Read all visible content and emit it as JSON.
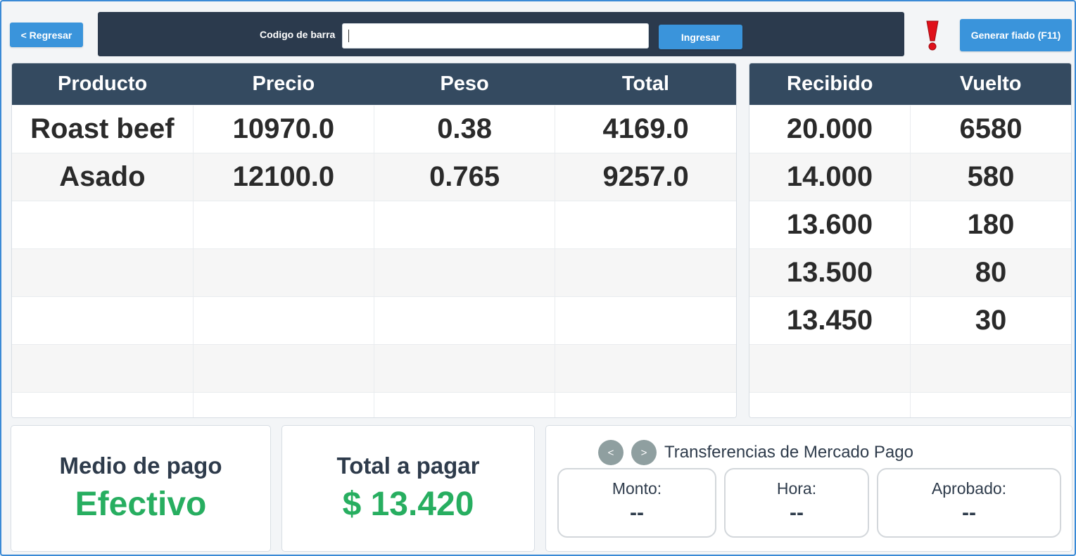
{
  "header": {
    "back_label": "< Regresar",
    "barcode_label": "Codigo de barra",
    "barcode_value": "",
    "submit_label": "Ingresar",
    "credit_label": "Generar fiado (F11)",
    "warning_icon": "exclamation-icon",
    "warning_color": "#e0101a"
  },
  "products": {
    "columns": [
      "Producto",
      "Precio",
      "Peso",
      "Total"
    ],
    "rows": [
      [
        "Roast beef",
        "10970.0",
        "0.38",
        "4169.0"
      ],
      [
        "Asado",
        "12100.0",
        "0.765",
        "9257.0"
      ]
    ]
  },
  "change": {
    "columns": [
      "Recibido",
      "Vuelto"
    ],
    "rows": [
      [
        "20.000",
        "6580"
      ],
      [
        "14.000",
        "580"
      ],
      [
        "13.600",
        "180"
      ],
      [
        "13.500",
        "80"
      ],
      [
        "13.450",
        "30"
      ]
    ]
  },
  "payment": {
    "method_title": "Medio de pago",
    "method_value": "Efectivo",
    "total_title": "Total a pagar",
    "total_value": "$  13.420"
  },
  "mercadopago": {
    "prev_label": "<",
    "next_label": ">",
    "title": "Transferencias de Mercado Pago",
    "boxes": [
      {
        "label": "Monto:",
        "value": "--"
      },
      {
        "label": "Hora:",
        "value": "--"
      },
      {
        "label": "Aprobado:",
        "value": "--"
      }
    ]
  },
  "colors": {
    "accent": "#3a94db",
    "header_bar": "#2b3a4d",
    "table_header": "#344a60",
    "success": "#27ae60"
  }
}
